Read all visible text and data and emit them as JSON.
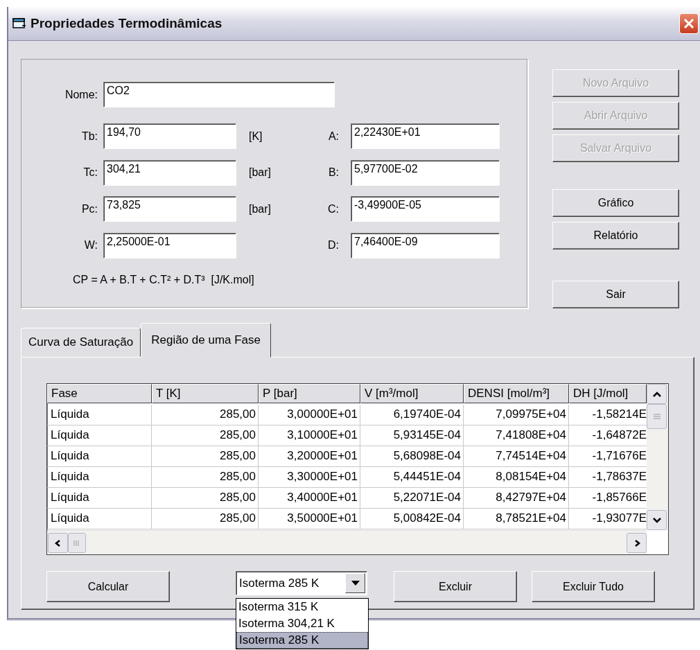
{
  "window": {
    "title": "Propriedades Termodinâmicas"
  },
  "properties": {
    "name": {
      "label": "Nome:",
      "value": "CO2"
    },
    "fields": [
      {
        "label": "Tb:",
        "value": "194,70",
        "unit": "[K]"
      },
      {
        "label": "Tc:",
        "value": "304,21",
        "unit": "[bar]"
      },
      {
        "label": "Pc:",
        "value": "73,825",
        "unit": "[bar]"
      },
      {
        "label": "W:",
        "value": "2,25000E-01"
      }
    ],
    "coefficients": [
      {
        "label": "A:",
        "value": "2,22430E+01"
      },
      {
        "label": "B:",
        "value": "5,97700E-02"
      },
      {
        "label": "C:",
        "value": "-3,49900E-05"
      },
      {
        "label": "D:",
        "value": "7,46400E-09"
      }
    ],
    "formula": "CP = A + B.T + C.T² + D.T³  [J/K.mol]"
  },
  "side_button_groups": [
    [
      {
        "label": "Novo Arquivo",
        "disabled": true
      },
      {
        "label": "Abrir Arquivo",
        "disabled": true
      },
      {
        "label": "Salvar Arquivo",
        "disabled": true
      }
    ],
    [
      {
        "label": "Gráfico",
        "disabled": false
      },
      {
        "label": "Relatório",
        "disabled": false
      }
    ],
    [
      {
        "label": "Sair",
        "disabled": false
      }
    ]
  ],
  "tabs": [
    {
      "label": "Curva de Saturação",
      "selected": false
    },
    {
      "label": "Região de uma Fase",
      "selected": true
    }
  ],
  "table": {
    "columns": [
      "Fase",
      "T [K]",
      "P [bar]",
      "V [m³/mol]",
      "DENSI [mol/m³]",
      "DH [J/mol]"
    ],
    "rows": [
      [
        "Líquida",
        "285,00",
        "3,00000E+01",
        "6,19740E-04",
        "7,09975E+04",
        "-1,58214E"
      ],
      [
        "Líquida",
        "285,00",
        "3,10000E+01",
        "5,93145E-04",
        "7,41808E+04",
        "-1,64872E"
      ],
      [
        "Líquida",
        "285,00",
        "3,20000E+01",
        "5,68098E-04",
        "7,74514E+04",
        "-1,71676E"
      ],
      [
        "Líquida",
        "285,00",
        "3,30000E+01",
        "5,44451E-04",
        "8,08154E+04",
        "-1,78637E"
      ],
      [
        "Líquida",
        "285,00",
        "3,40000E+01",
        "5,22071E-04",
        "8,42797E+04",
        "-1,85766E"
      ],
      [
        "Líquida",
        "285,00",
        "3,50000E+01",
        "5,00842E-04",
        "8,78521E+04",
        "-1,93077E"
      ]
    ]
  },
  "actions": {
    "calculate": "Calcular",
    "delete": "Excluir",
    "delete_all": "Excluir Tudo",
    "isotherm_select": {
      "value": "Isoterma 285 K",
      "expanded": true,
      "options": [
        {
          "label": "Isoterma 315 K",
          "selected": false
        },
        {
          "label": "Isoterma 304,21 K",
          "selected": false
        },
        {
          "label": "Isoterma 285 K",
          "selected": true
        }
      ]
    }
  }
}
